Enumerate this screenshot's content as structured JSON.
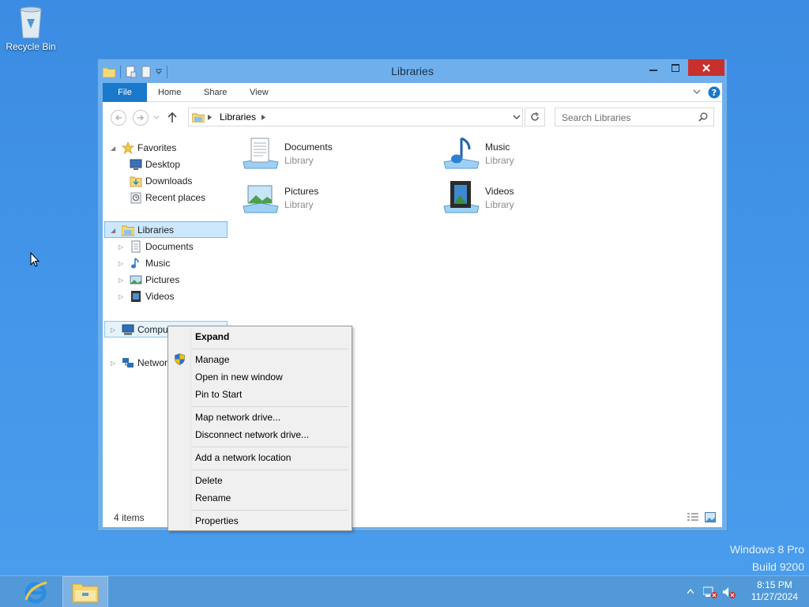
{
  "desktop": {
    "recycle_bin_label": "Recycle Bin",
    "watermark_line1": "Windows 8 Pro",
    "watermark_line2": "Build 9200"
  },
  "window": {
    "title": "Libraries",
    "ribbon_tabs": [
      "File",
      "Home",
      "Share",
      "View"
    ],
    "address_path": "Libraries",
    "search_placeholder": "Search Libraries",
    "status_text": "4 items"
  },
  "nav_pane": {
    "favorites_label": "Favorites",
    "favorites": [
      "Desktop",
      "Downloads",
      "Recent places"
    ],
    "libraries_label": "Libraries",
    "libraries": [
      "Documents",
      "Music",
      "Pictures",
      "Videos"
    ],
    "computer_label": "Compute",
    "network_label": "Network"
  },
  "content_items": [
    {
      "name": "Documents",
      "type": "Library",
      "icon": "documents-library-icon"
    },
    {
      "name": "Music",
      "type": "Library",
      "icon": "music-library-icon"
    },
    {
      "name": "Pictures",
      "type": "Library",
      "icon": "pictures-library-icon"
    },
    {
      "name": "Videos",
      "type": "Library",
      "icon": "videos-library-icon"
    }
  ],
  "context_menu": {
    "expand": "Expand",
    "manage": "Manage",
    "open_new_window": "Open in new window",
    "pin_to_start": "Pin to Start",
    "map_network_drive": "Map network drive...",
    "disconnect_network_drive": "Disconnect network drive...",
    "add_network_location": "Add a network location",
    "delete": "Delete",
    "rename": "Rename",
    "properties": "Properties"
  },
  "taskbar": {
    "time": "8:15 PM",
    "date": "11/27/2024"
  },
  "colors": {
    "accent": "#1979ca",
    "close_button": "#c7302d",
    "desktop": "#3f8fe0",
    "selection": "#cce8ff"
  }
}
